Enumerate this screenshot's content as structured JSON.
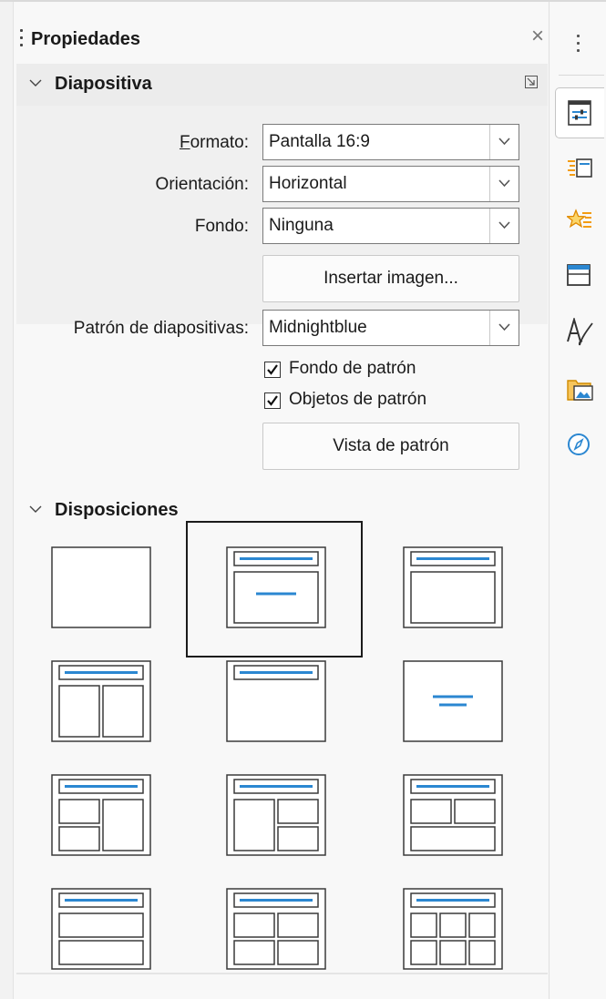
{
  "panel": {
    "title": "Propiedades"
  },
  "slide_section": {
    "title": "Diapositiva",
    "format_label": "Formato:",
    "format_value": "Pantalla 16:9",
    "orientation_label": "Orientación:",
    "orientation_value": "Horizontal",
    "background_label": "Fondo:",
    "background_value": "Ninguna",
    "insert_image_label": "Insertar imagen...",
    "master_label": "Patrón de diapositivas:",
    "master_value": "Midnightblue",
    "master_bg_label": "Fondo de patrón",
    "master_bg_checked": true,
    "master_objects_label": "Objetos de patrón",
    "master_objects_checked": true,
    "master_view_label": "Vista de patrón"
  },
  "layouts_section": {
    "title": "Disposiciones",
    "selected_index": 1,
    "layouts": [
      "blank",
      "title-content",
      "title-only-content",
      "title-two-content",
      "title-only",
      "centered-text",
      "title-2content-left",
      "title-content-2right",
      "title-2top-content",
      "title-content-content",
      "title-4content",
      "title-6content"
    ]
  },
  "tabbar": {
    "tabs": [
      "properties-icon",
      "slide-transition-icon",
      "animation-icon",
      "master-slides-icon",
      "styles-icon",
      "gallery-icon",
      "navigator-icon"
    ],
    "active_index": 0
  },
  "colors": {
    "accent": "#2b87d1",
    "frame": "#3a3a3a",
    "icon_orange": "#f39c12"
  }
}
